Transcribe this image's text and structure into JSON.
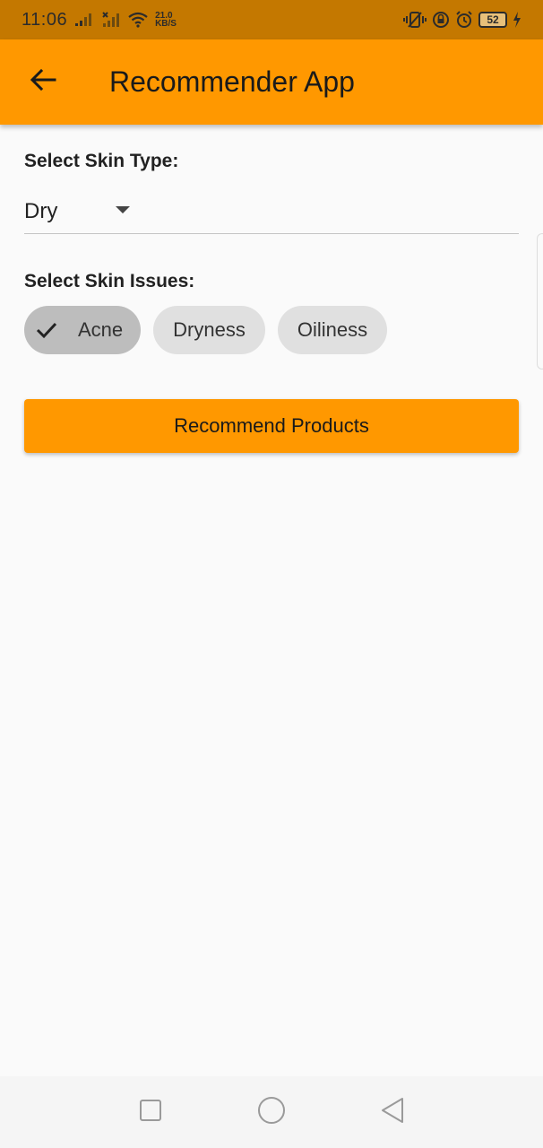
{
  "status_bar": {
    "time": "11:06",
    "speed_value": "21.0",
    "speed_unit": "KB/S",
    "battery": "52",
    "icons": [
      "signal-icon",
      "signal-x-icon",
      "wifi-icon",
      "vibrate-icon",
      "lock-rotation-icon",
      "alarm-icon",
      "battery-icon",
      "charging-icon"
    ]
  },
  "app_bar": {
    "title": "Recommender App",
    "back_icon": "arrow-left-icon"
  },
  "skin_type": {
    "label": "Select Skin Type:",
    "selected": "Dry",
    "caret_icon": "caret-down-icon"
  },
  "skin_issues": {
    "label": "Select Skin Issues:",
    "chips": [
      {
        "label": "Acne",
        "selected": true
      },
      {
        "label": "Dryness",
        "selected": false
      },
      {
        "label": "Oiliness",
        "selected": false
      }
    ]
  },
  "actions": {
    "recommend_label": "Recommend Products"
  },
  "nav_bar": {
    "icons": [
      "recents-square-icon",
      "home-circle-icon",
      "back-triangle-icon"
    ]
  },
  "colors": {
    "primary": "#ff9800",
    "status_bar": "#c47800",
    "chip": "#e0e0e0",
    "chip_selected": "#bdbdbd",
    "background": "#fafafa"
  }
}
